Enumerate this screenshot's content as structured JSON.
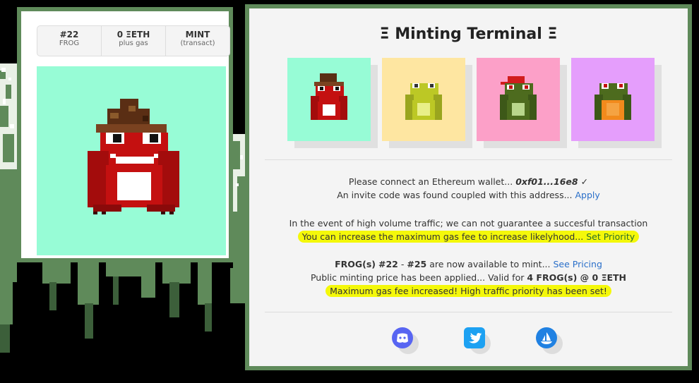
{
  "stats": [
    {
      "big": "#22",
      "small": "FROG"
    },
    {
      "big": "0 ΞETH",
      "small": "plus gas"
    },
    {
      "big": "MINT",
      "small": "(transact)"
    }
  ],
  "header": {
    "title": "Ξ Minting Terminal Ξ"
  },
  "thumbnails": [
    {
      "name": "red-hat-frog",
      "bg": "#97fcd6"
    },
    {
      "name": "yellow-frog",
      "bg": "#fee6a1"
    },
    {
      "name": "cap-frog",
      "bg": "#fca0c8"
    },
    {
      "name": "orange-shirt-frog",
      "bg": "#e59efc"
    }
  ],
  "wallet": {
    "prefix": "Please connect an Ethereum wallet...",
    "address": "0xf01...16e8",
    "check": "✓",
    "invite_text": "An invite code was found coupled with this address...",
    "invite_link": "Apply"
  },
  "traffic": {
    "warning": "In the event of high volume traffic; we can not guarantee a succesful transaction",
    "gas_text": "You can increase the maximum gas fee to increase likelyhood...",
    "gas_link": "Set Priority"
  },
  "mint": {
    "frogs_bold": "FROG(s)",
    "range_a": "#22",
    "dash": "-",
    "range_b": "#25",
    "avail_text": "are now available to mint...",
    "pricing_link": "See Pricing",
    "price_text": "Public minting price has been applied... Valid for",
    "price_bold": "4 FROG(s) @ 0 ΞETH",
    "priority_msg": "Maximum gas fee increased! High traffic priority has been set!"
  },
  "social": [
    {
      "name": "discord-icon",
      "color": "#5865f2"
    },
    {
      "name": "twitter-icon",
      "color": "#1da1f2"
    },
    {
      "name": "opensea-icon",
      "color": "#2081e2"
    }
  ]
}
